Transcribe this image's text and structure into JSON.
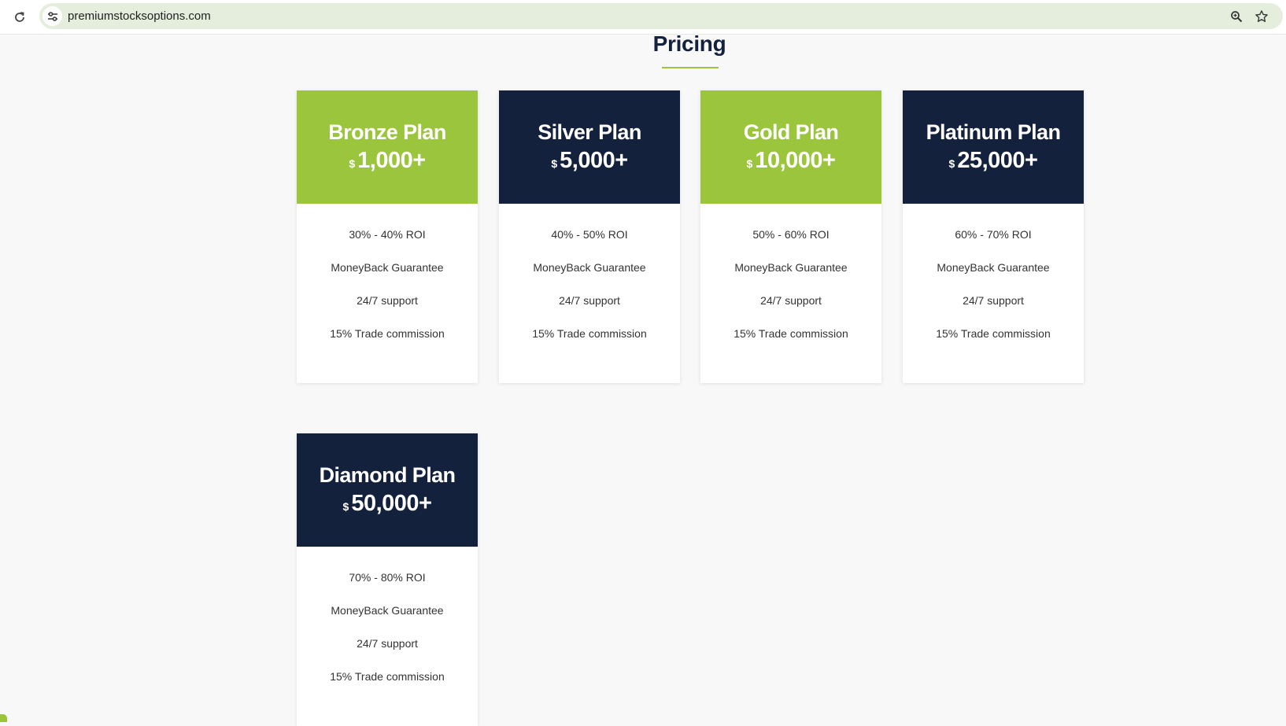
{
  "browser": {
    "url": "premiumstocksoptions.com",
    "icons": [
      "reload-icon",
      "site-info-icon",
      "zoom-icon",
      "star-icon"
    ]
  },
  "page": {
    "title": "Pricing"
  },
  "colors": {
    "accent_green": "#9bc53d",
    "navy": "#14213d",
    "background": "#f8f8f8"
  },
  "plans": [
    {
      "name": "Bronze Plan",
      "currency": "$",
      "amount": "1,000+",
      "header_color": "green",
      "features": [
        "30% - 40% ROI",
        "MoneyBack Guarantee",
        "24/7 support",
        "15% Trade commission"
      ]
    },
    {
      "name": "Silver Plan",
      "currency": "$",
      "amount": "5,000+",
      "header_color": "navy",
      "features": [
        "40% - 50% ROI",
        "MoneyBack Guarantee",
        "24/7 support",
        "15% Trade commission"
      ]
    },
    {
      "name": "Gold Plan",
      "currency": "$",
      "amount": "10,000+",
      "header_color": "green",
      "features": [
        "50% - 60% ROI",
        "MoneyBack Guarantee",
        "24/7 support",
        "15% Trade commission"
      ]
    },
    {
      "name": "Platinum Plan",
      "currency": "$",
      "amount": "25,000+",
      "header_color": "navy",
      "features": [
        "60% - 70% ROI",
        "MoneyBack Guarantee",
        "24/7 support",
        "15% Trade commission"
      ]
    },
    {
      "name": "Diamond Plan",
      "currency": "$",
      "amount": "50,000+",
      "header_color": "navy",
      "features": [
        "70% - 80% ROI",
        "MoneyBack Guarantee",
        "24/7 support",
        "15% Trade commission"
      ]
    }
  ]
}
